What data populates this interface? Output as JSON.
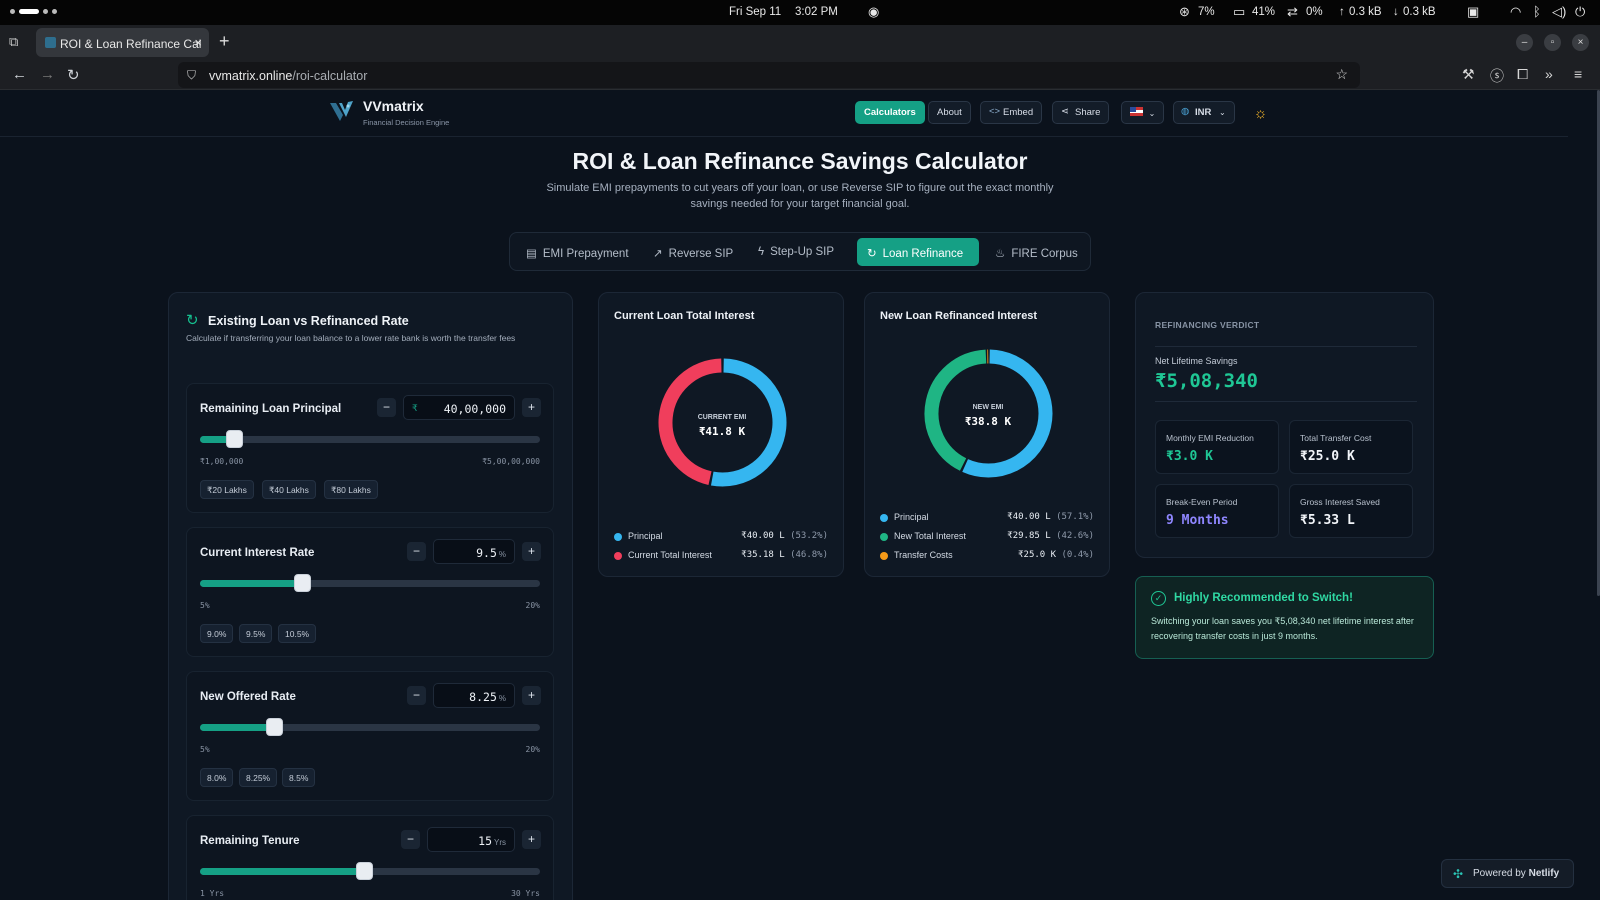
{
  "os": {
    "date": "Fri Sep 11",
    "time": "3:02 PM",
    "cpu": "7%",
    "memory": "41%",
    "swap": "0%",
    "upload": "0.3 kB",
    "download": "0.3 kB"
  },
  "browser": {
    "tab_title": "ROI & Loan Refinance Cal",
    "url_host": "vvmatrix.online",
    "url_path": "/roi-calculator"
  },
  "header": {
    "brand": "VVmatrix",
    "tagline": "Financial Decision Engine",
    "nav": {
      "calculators": "Calculators",
      "about": "About",
      "embed": "Embed",
      "share": "Share",
      "currency": "INR"
    }
  },
  "page": {
    "title": "ROI & Loan Refinance Savings Calculator",
    "subtitle": "Simulate EMI prepayments to cut years off your loan, or use Reverse SIP to figure out the exact monthly savings needed for your target financial goal."
  },
  "tabs": [
    "EMI Prepayment",
    "Reverse SIP",
    "Step-Up SIP",
    "Loan Refinance",
    "FIRE Corpus"
  ],
  "active_tab": "Loan Refinance",
  "form": {
    "title": "Existing Loan vs Refinanced Rate",
    "desc": "Calculate if transferring your loan balance to a lower rate bank is worth the transfer fees",
    "principal": {
      "label": "Remaining Loan Principal",
      "value": "40,00,000",
      "prefix": "₹",
      "min": "₹1,00,000",
      "max": "₹5,00,00,000",
      "fraction": 0.1,
      "presets": [
        "₹20 Lakhs",
        "₹40 Lakhs",
        "₹80 Lakhs"
      ]
    },
    "current_rate": {
      "label": "Current Interest Rate",
      "value": "9.5",
      "unit": "%",
      "min": "5%",
      "max": "20%",
      "fraction": 0.3,
      "presets": [
        "9.0%",
        "9.5%",
        "10.5%"
      ]
    },
    "new_rate": {
      "label": "New Offered Rate",
      "value": "8.25",
      "unit": "%",
      "min": "5%",
      "max": "20%",
      "fraction": 0.2167,
      "presets": [
        "8.0%",
        "8.25%",
        "8.5%"
      ]
    },
    "tenure": {
      "label": "Remaining Tenure",
      "value": "15",
      "unit": "Yrs",
      "min": "1 Yrs",
      "max": "30 Yrs",
      "fraction": 0.4828
    }
  },
  "current_chart": {
    "title": "Current Loan Total Interest",
    "center_label": "CURRENT EMI",
    "center_value": "₹41.8 K",
    "legend": [
      {
        "name": "Principal",
        "value": "₹40.00 L",
        "pct": "(53.2%)",
        "share": 53.2,
        "color": "#35b6f0"
      },
      {
        "name": "Current Total Interest",
        "value": "₹35.18 L",
        "pct": "(46.8%)",
        "share": 46.8,
        "color": "#f03e5c"
      }
    ]
  },
  "new_chart": {
    "title": "New Loan Refinanced Interest",
    "center_label": "NEW EMI",
    "center_value": "₹38.8 K",
    "legend": [
      {
        "name": "Principal",
        "value": "₹40.00 L",
        "pct": "(57.1%)",
        "share": 57.1,
        "color": "#35b6f0"
      },
      {
        "name": "New Total Interest",
        "value": "₹29.85 L",
        "pct": "(42.6%)",
        "share": 42.6,
        "color": "#1fb584"
      },
      {
        "name": "Transfer Costs",
        "value": "₹25.0 K",
        "pct": "(0.4%)",
        "share": 0.4,
        "color": "#f59a18"
      }
    ]
  },
  "verdict": {
    "heading": "REFINANCING VERDICT",
    "net_label": "Net Lifetime Savings",
    "net_value": "₹5,08,340",
    "stats": [
      {
        "label": "Monthly EMI Reduction",
        "value": "₹3.0 K",
        "color": "#1fc795"
      },
      {
        "label": "Total Transfer Cost",
        "value": "₹25.0 K",
        "color": "#f2f5f9"
      },
      {
        "label": "Break-Even Period",
        "value": "9 Months",
        "color": "#8f86ff"
      },
      {
        "label": "Gross Interest Saved",
        "value": "₹5.33 L",
        "color": "#f2f5f9"
      }
    ]
  },
  "recommendation": {
    "title": "Highly Recommended to Switch!",
    "text": "Switching your loan saves you ₹5,08,340 net lifetime interest after recovering transfer costs in just 9 months."
  },
  "footer": {
    "powered_by": "Powered by",
    "provider": "Netlify"
  },
  "colors": {
    "accent": "#15a085",
    "background": "#0b121c",
    "card": "#0f1824"
  }
}
